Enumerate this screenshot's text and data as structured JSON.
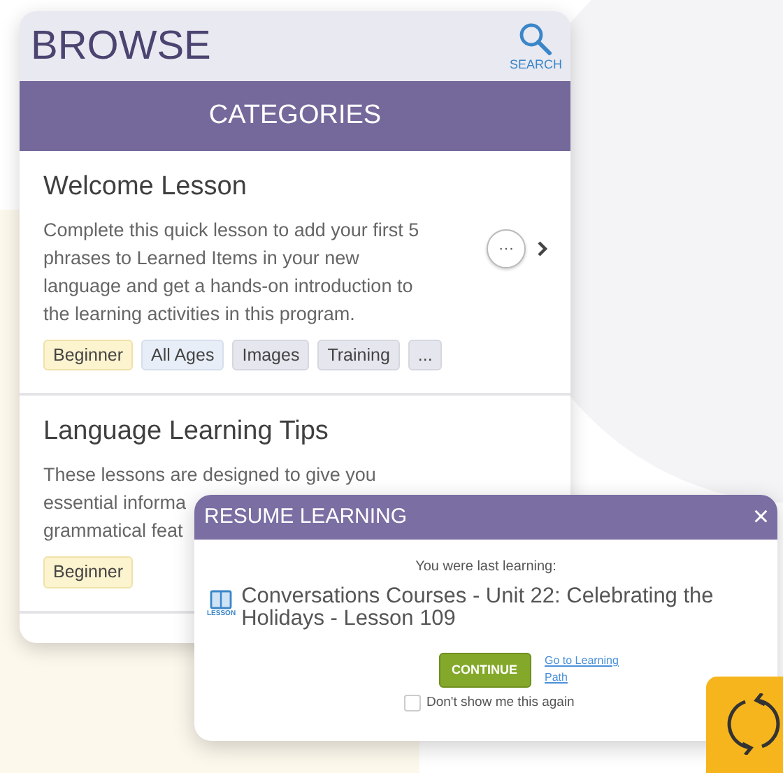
{
  "browse": {
    "title": "BROWSE",
    "search_label": "SEARCH",
    "tab": "CATEGORIES",
    "items": [
      {
        "title": "Welcome Lesson",
        "lines": [
          "Complete this quick lesson to add your first 5",
          "phrases to Learned Items in your new",
          "language and get a hands-on introduction to",
          "the learning activities in this program."
        ],
        "more_button": "···",
        "tags": [
          {
            "label": "Beginner",
            "kind": "level"
          },
          {
            "label": "All Ages",
            "kind": "age"
          },
          {
            "label": "Images",
            "kind": "topic"
          },
          {
            "label": "Training",
            "kind": "topic"
          },
          {
            "label": "...",
            "kind": "topic"
          }
        ]
      },
      {
        "title": "Language Learning Tips",
        "lines": [
          "These lessons are designed to give you",
          "essential informa",
          "grammatical feat"
        ],
        "tags": [
          {
            "label": "Beginner",
            "kind": "level"
          }
        ]
      }
    ]
  },
  "dialog": {
    "title": "RESUME LEARNING",
    "close": "×",
    "intro": "You were last learning:",
    "icon_label": "LESSON",
    "lesson": "Conversations Courses - Unit 22: Celebrating the Holidays - Lesson 109",
    "continue": "CONTINUE",
    "link": "Go to Learning Path",
    "dont_show": {
      "label": "Don't show me this again",
      "checked": false
    }
  }
}
